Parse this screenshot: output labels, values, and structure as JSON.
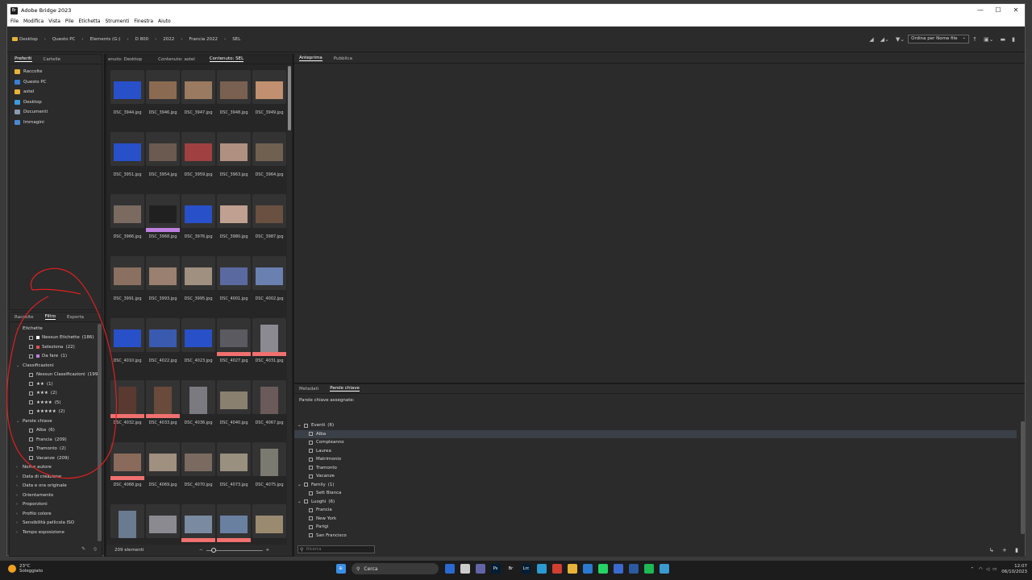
{
  "window": {
    "title": "Adobe Bridge 2023",
    "controls": {
      "minimize": "—",
      "maximize": "☐",
      "close": "✕"
    }
  },
  "menu": [
    "File",
    "Modifica",
    "Vista",
    "Pile",
    "Etichetta",
    "Strumenti",
    "Finestra",
    "Aiuto"
  ],
  "breadcrumb": [
    "Desktop",
    "Questo PC",
    "Elements (G:)",
    "D 800",
    "2022",
    "Francia 2022",
    "SEL"
  ],
  "sort": {
    "label": "Ordina per Nome file"
  },
  "favorites_panel": {
    "tabs": [
      "Preferiti",
      "Cartelle"
    ],
    "items": [
      {
        "label": "Raccolte",
        "color": "#e8b33a"
      },
      {
        "label": "Questo PC",
        "color": "#3a7fd0"
      },
      {
        "label": "astel",
        "color": "#e8b33a"
      },
      {
        "label": "Desktop",
        "color": "#3a9de0"
      },
      {
        "label": "Documenti",
        "color": "#8a9ab0"
      },
      {
        "label": "Immagini",
        "color": "#4a8ad0"
      }
    ]
  },
  "filter_panel": {
    "tabs": [
      "Raccolte",
      "Filtro",
      "Esporta"
    ],
    "sections": [
      {
        "title": "Etichette",
        "items": [
          {
            "label": "Nessun Etichette",
            "count": "(186)",
            "swatch": "#ffffff"
          },
          {
            "label": "Seleziona",
            "count": "(22)",
            "swatch": "#e05050"
          },
          {
            "label": "Da fare",
            "count": "(1)",
            "swatch": "#c080e0"
          }
        ]
      },
      {
        "title": "Classificazioni",
        "items": [
          {
            "label": "Nessun Classificazioni",
            "count": "(199)"
          },
          {
            "label": "★★",
            "count": "(1)"
          },
          {
            "label": "★★★",
            "count": "(2)"
          },
          {
            "label": "★★★★",
            "count": "(5)"
          },
          {
            "label": "★★★★★",
            "count": "(2)"
          }
        ]
      },
      {
        "title": "Parole chiave",
        "items": [
          {
            "label": "Alba",
            "count": "(6)"
          },
          {
            "label": "Francia",
            "count": "(209)"
          },
          {
            "label": "Tramonto",
            "count": "(2)"
          },
          {
            "label": "Vacanze",
            "count": "(209)"
          }
        ]
      }
    ],
    "collapsed": [
      "Nome autore",
      "Data di creazione",
      "Data e ora originale",
      "Orientamento",
      "Proporzioni",
      "Profilo colore",
      "Sensibilità pellicola ISO",
      "Tempo esposizione"
    ]
  },
  "content_panel": {
    "tabs": [
      "enuto: Desktop",
      "Contenuto: astel",
      "Contenuto: SEL"
    ],
    "count": "209 elementi",
    "thumbnails": [
      {
        "name": "DSC_3944.jpg",
        "color": "#2850c8"
      },
      {
        "name": "DSC_3946.jpg",
        "color": "#8a6a50"
      },
      {
        "name": "DSC_3947.jpg",
        "color": "#9a7a60"
      },
      {
        "name": "DSC_3948.jpg",
        "color": "#7a6050"
      },
      {
        "name": "DSC_3949.jpg",
        "color": "#c09070"
      },
      {
        "name": "DSC_3951.jpg",
        "color": "#2850c8"
      },
      {
        "name": "DSC_3954.jpg",
        "color": "#6a5a50"
      },
      {
        "name": "DSC_3959.jpg",
        "color": "#a04040"
      },
      {
        "name": "DSC_3963.jpg",
        "color": "#b09080"
      },
      {
        "name": "DSC_3964.jpg",
        "color": "#706050"
      },
      {
        "name": "DSC_3966.jpg",
        "color": "#7a6a60"
      },
      {
        "name": "DSC_3968.jpg",
        "color": "#202020",
        "label": "#c080e0"
      },
      {
        "name": "DSC_3976.jpg",
        "color": "#2850c8"
      },
      {
        "name": "DSC_3980.jpg",
        "color": "#c0a090"
      },
      {
        "name": "DSC_3987.jpg",
        "color": "#6a5040"
      },
      {
        "name": "DSC_3991.jpg",
        "color": "#8a7060"
      },
      {
        "name": "DSC_3993.jpg",
        "color": "#9a8070"
      },
      {
        "name": "DSC_3995.jpg",
        "color": "#a09080"
      },
      {
        "name": "DSC_4001.jpg",
        "color": "#5a6aa0"
      },
      {
        "name": "DSC_4002.jpg",
        "color": "#6a80b0"
      },
      {
        "name": "DSC_4010.jpg",
        "color": "#2850c8"
      },
      {
        "name": "DSC_4022.jpg",
        "color": "#3a5ab0"
      },
      {
        "name": "DSC_4023.jpg",
        "color": "#2850c8"
      },
      {
        "name": "DSC_4027.jpg",
        "color": "#5a5a60",
        "label": "#f07070"
      },
      {
        "name": "DSC_4031.jpg",
        "color": "#8a8a90",
        "label": "#f07070",
        "portrait": true
      },
      {
        "name": "DSC_4032.jpg",
        "color": "#5a3a30",
        "label": "#f07070",
        "portrait": true
      },
      {
        "name": "DSC_4033.jpg",
        "color": "#6a4a3a",
        "label": "#f07070",
        "portrait": true
      },
      {
        "name": "DSC_4036.jpg",
        "color": "#7a7a80",
        "portrait": true
      },
      {
        "name": "DSC_4040.jpg",
        "color": "#8a8070"
      },
      {
        "name": "DSC_4067.jpg",
        "color": "#6a5a5a",
        "portrait": true
      },
      {
        "name": "DSC_4068.jpg",
        "color": "#8a6a5a",
        "label": "#f07070"
      },
      {
        "name": "DSC_4069.jpg",
        "color": "#a09080"
      },
      {
        "name": "DSC_4070.jpg",
        "color": "#7a6a60"
      },
      {
        "name": "DSC_4073.jpg",
        "color": "#9a9080"
      },
      {
        "name": "DSC_4075.jpg",
        "color": "#7a7a70",
        "portrait": true
      },
      {
        "name": "",
        "color": "#6a7a90",
        "portrait": true
      },
      {
        "name": "",
        "color": "#8a8a90"
      },
      {
        "name": "",
        "color": "#7a8aa0",
        "label": "#f07070"
      },
      {
        "name": "",
        "color": "#6a80a0",
        "label": "#f07070"
      },
      {
        "name": "",
        "color": "#9a8a70"
      }
    ]
  },
  "preview_panel": {
    "tabs": [
      "Anteprima",
      "Pubblica"
    ]
  },
  "keywords_panel": {
    "tabs": [
      "Metadati",
      "Parole chiave"
    ],
    "assigned_label": "Parole chiave assegnate:",
    "search_placeholder": "Ricerca",
    "tree": [
      {
        "label": "Eventi",
        "count": "(6)",
        "children": [
          "Alba",
          "Compleanno",
          "Laurea",
          "Matrimonio",
          "Tramonto",
          "Vacanze"
        ]
      },
      {
        "label": "Family",
        "count": "(1)",
        "children": [
          "Sett Bianca"
        ]
      },
      {
        "label": "Luoghi",
        "count": "(6)",
        "children": [
          "Francia",
          "New York",
          "Parigi",
          "San Francisco"
        ]
      }
    ]
  },
  "taskbar": {
    "weather_temp": "23°C",
    "weather_desc": "Soleggiato",
    "search": "Cerca",
    "time": "12:07",
    "date": "06/10/2023",
    "apps": [
      {
        "name": "windows-start-icon",
        "color": "#3a8ee6",
        "text": "⊞"
      },
      {
        "name": "copilot-icon",
        "color": "#2a6ad0",
        "text": ""
      },
      {
        "name": "file-explorer-icon",
        "color": "#ccc",
        "text": ""
      },
      {
        "name": "teams-icon",
        "color": "#6264a7",
        "text": ""
      },
      {
        "name": "photoshop-icon",
        "color": "#001e36",
        "text": "Ps"
      },
      {
        "name": "bridge-icon",
        "color": "#1d1d1d",
        "text": "Br"
      },
      {
        "name": "lightroom-icon",
        "color": "#001e36",
        "text": "Lrc"
      },
      {
        "name": "edge-icon",
        "color": "#2a9ad0",
        "text": ""
      },
      {
        "name": "chrome-icon",
        "color": "#d04030",
        "text": ""
      },
      {
        "name": "folder-icon",
        "color": "#e8b33a",
        "text": ""
      },
      {
        "name": "mail-icon",
        "color": "#2a7ad0",
        "text": ""
      },
      {
        "name": "whatsapp-icon",
        "color": "#25d366",
        "text": ""
      },
      {
        "name": "app-icon",
        "color": "#3a6ad0",
        "text": ""
      },
      {
        "name": "vpn-icon",
        "color": "#2a5aa0",
        "text": ""
      },
      {
        "name": "spotify-icon",
        "color": "#1db954",
        "text": ""
      },
      {
        "name": "globe-icon",
        "color": "#3a9ad0",
        "text": ""
      }
    ]
  }
}
